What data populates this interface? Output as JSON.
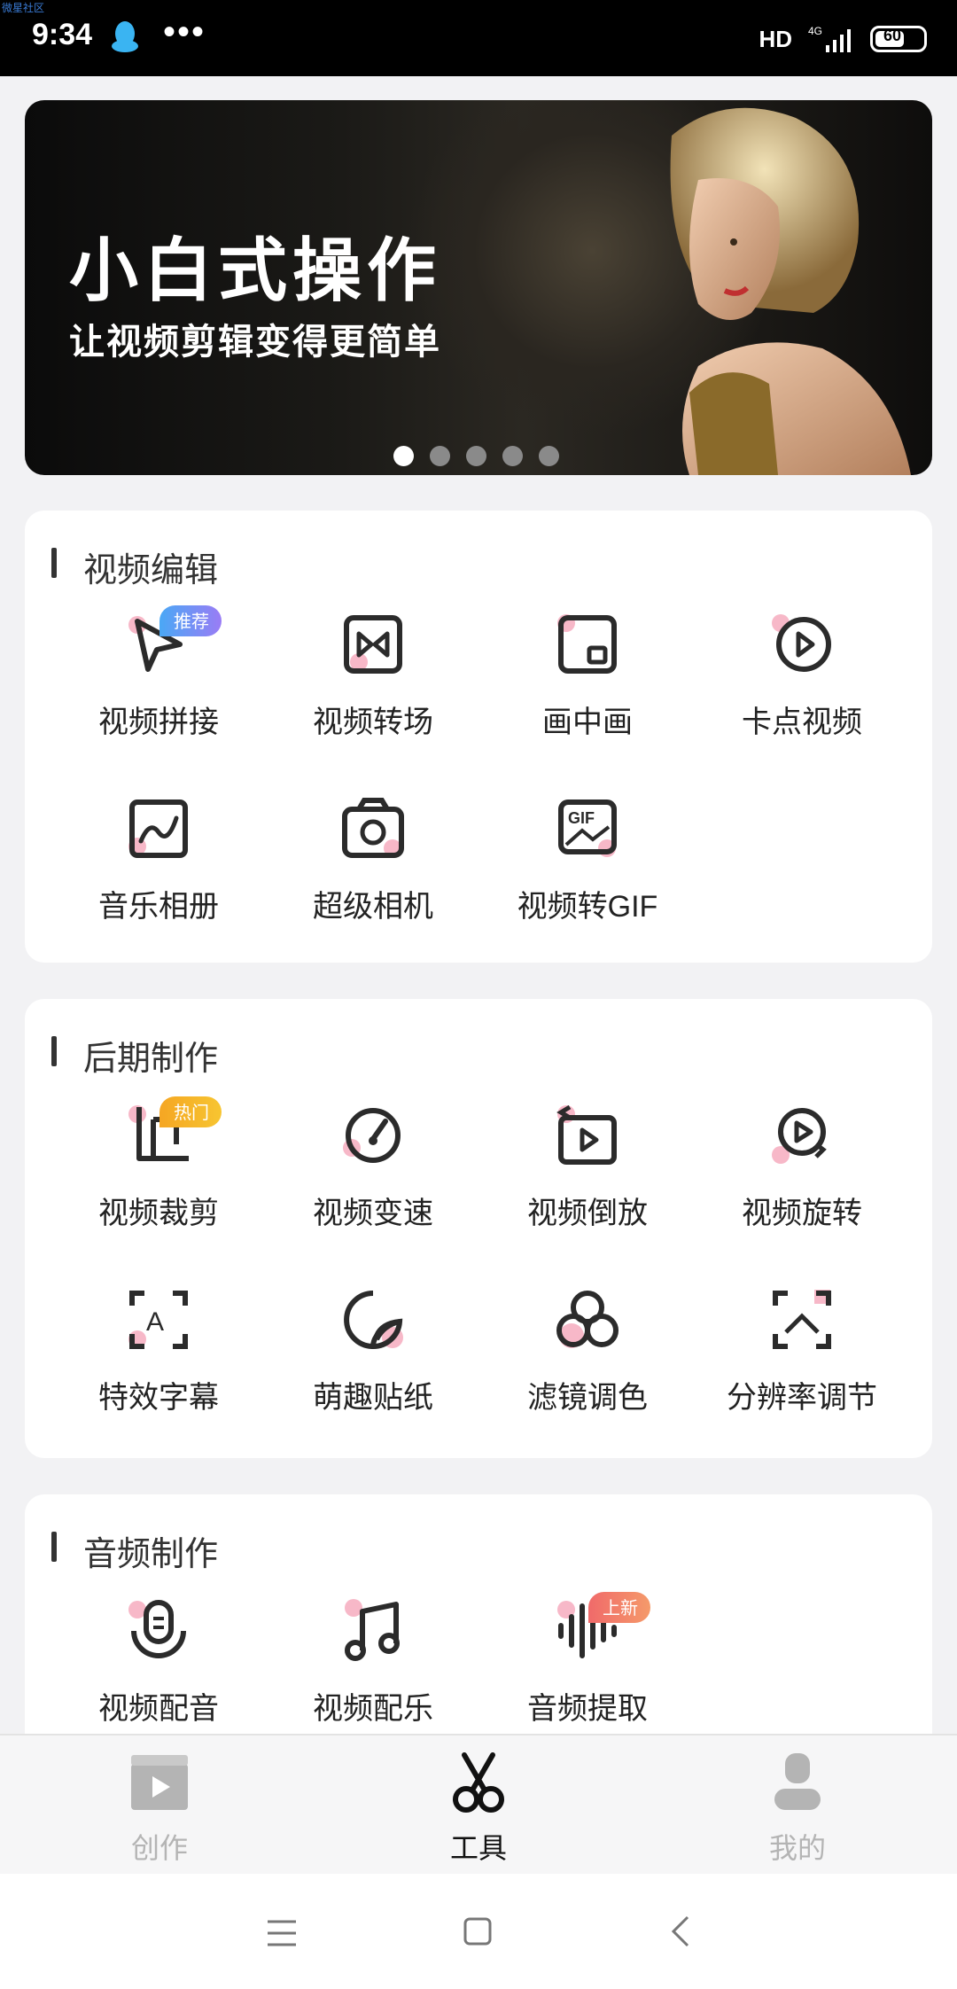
{
  "status_bar": {
    "corner_tag": "微星社区",
    "time": "9:34",
    "more": "•••",
    "hd": "HD",
    "network": "4G",
    "battery": "60"
  },
  "banner": {
    "title": "小白式操作",
    "subtitle": "让视频剪辑变得更简单",
    "page_count": 5,
    "active_index": 0
  },
  "sections": [
    {
      "title": "视频编辑",
      "tools": [
        {
          "label": "视频拼接",
          "icon": "play-cursor-icon",
          "badge": "推荐"
        },
        {
          "label": "视频转场",
          "icon": "transition-icon"
        },
        {
          "label": "画中画",
          "icon": "picture-in-picture-icon"
        },
        {
          "label": "卡点视频",
          "icon": "play-circle-icon"
        },
        {
          "label": "音乐相册",
          "icon": "music-wave-icon"
        },
        {
          "label": "超级相机",
          "icon": "camera-icon"
        },
        {
          "label": "视频转GIF",
          "icon": "gif-icon"
        }
      ]
    },
    {
      "title": "后期制作",
      "tools": [
        {
          "label": "视频裁剪",
          "icon": "crop-icon",
          "badge": "热门"
        },
        {
          "label": "视频变速",
          "icon": "speedometer-icon"
        },
        {
          "label": "视频倒放",
          "icon": "reverse-play-icon"
        },
        {
          "label": "视频旋转",
          "icon": "rotate-icon"
        },
        {
          "label": "特效字幕",
          "icon": "subtitle-icon"
        },
        {
          "label": "萌趣贴纸",
          "icon": "sticker-icon"
        },
        {
          "label": "滤镜调色",
          "icon": "filter-icon"
        },
        {
          "label": "分辨率调节",
          "icon": "resolution-icon"
        }
      ]
    },
    {
      "title": "音频制作",
      "tools": [
        {
          "label": "视频配音",
          "icon": "microphone-icon"
        },
        {
          "label": "视频配乐",
          "icon": "music-note-icon"
        },
        {
          "label": "音频提取",
          "icon": "audio-wave-icon",
          "badge": "上新"
        }
      ]
    }
  ],
  "bottom_nav": [
    {
      "label": "创作",
      "icon": "clapperboard-icon",
      "active": false
    },
    {
      "label": "工具",
      "icon": "scissors-icon",
      "active": true
    },
    {
      "label": "我的",
      "icon": "user-icon",
      "active": false
    }
  ],
  "colors": {
    "accent_pink": "#f7b8c8",
    "badge_recommend": "#8a7cf5",
    "badge_hot": "#f5a623",
    "badge_new": "#f06a6a",
    "icon_stroke": "#2b2b2b",
    "nav_inactive": "#b4b4b4",
    "nav_active": "#111111"
  }
}
